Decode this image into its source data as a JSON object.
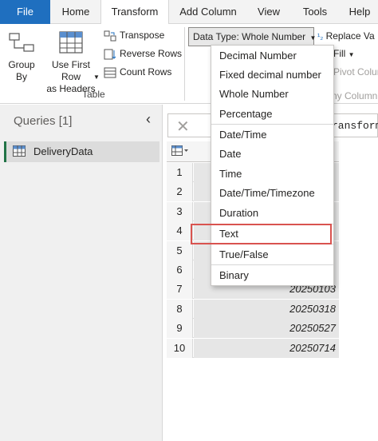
{
  "tabs": [
    {
      "label": "File"
    },
    {
      "label": "Home"
    },
    {
      "label": "Transform"
    },
    {
      "label": "Add Column"
    },
    {
      "label": "View"
    },
    {
      "label": "Tools"
    },
    {
      "label": "Help"
    }
  ],
  "ribbon": {
    "group_by": "Group\nBy",
    "first_row": "Use First Row\nas Headers",
    "transpose": "Transpose",
    "reverse_rows": "Reverse Rows",
    "count_rows": "Count Rows",
    "table_group": "Table",
    "data_type": "Data Type: Whole Number",
    "replace_values": "Replace Va",
    "fill": "Fill",
    "pivot_column": "Pivot Column",
    "unpivot_column": "ny Column"
  },
  "queries": {
    "title": "Queries [1]",
    "items": [
      {
        "label": "DeliveryData"
      }
    ]
  },
  "formula_bar": {
    "text": "ransform"
  },
  "menu": {
    "items": [
      "Decimal Number",
      "Fixed decimal number",
      "Whole Number",
      "Percentage",
      "Date/Time",
      "Date",
      "Time",
      "Date/Time/Timezone",
      "Duration",
      "Text",
      "True/False",
      "Binary"
    ],
    "highlighted": "Text",
    "highlight_color": "#d9534f"
  },
  "grid": {
    "rows": [
      {
        "n": "1",
        "v": ""
      },
      {
        "n": "2",
        "v": ""
      },
      {
        "n": "3",
        "v": ""
      },
      {
        "n": "4",
        "v": ""
      },
      {
        "n": "5",
        "v": ""
      },
      {
        "n": "6",
        "v": ""
      },
      {
        "n": "7",
        "v": "20250103"
      },
      {
        "n": "8",
        "v": "20250318"
      },
      {
        "n": "9",
        "v": "20250527"
      },
      {
        "n": "10",
        "v": "20250714"
      }
    ]
  }
}
